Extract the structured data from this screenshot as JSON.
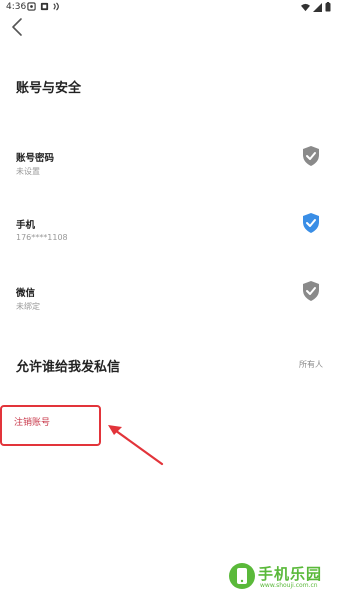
{
  "status_bar": {
    "time": "4:36"
  },
  "page": {
    "title": "账号与安全"
  },
  "rows": [
    {
      "label": "账号密码",
      "sub": "未设置",
      "shield_color": "#8a8a8a"
    },
    {
      "label": "手机",
      "sub": "176****1108",
      "shield_color": "#3a8ee6"
    },
    {
      "label": "微信",
      "sub": "未绑定",
      "shield_color": "#8a8a8a"
    }
  ],
  "dm": {
    "title": "允许谁给我发私信",
    "value": "所有人"
  },
  "cancel": {
    "label": "注销账号",
    "color": "#c8384a"
  },
  "annotation": {
    "color": "#e2343a"
  },
  "watermark": {
    "text": "手机乐园",
    "url": "www.shouji.com.cn",
    "color": "#5ab93a"
  }
}
